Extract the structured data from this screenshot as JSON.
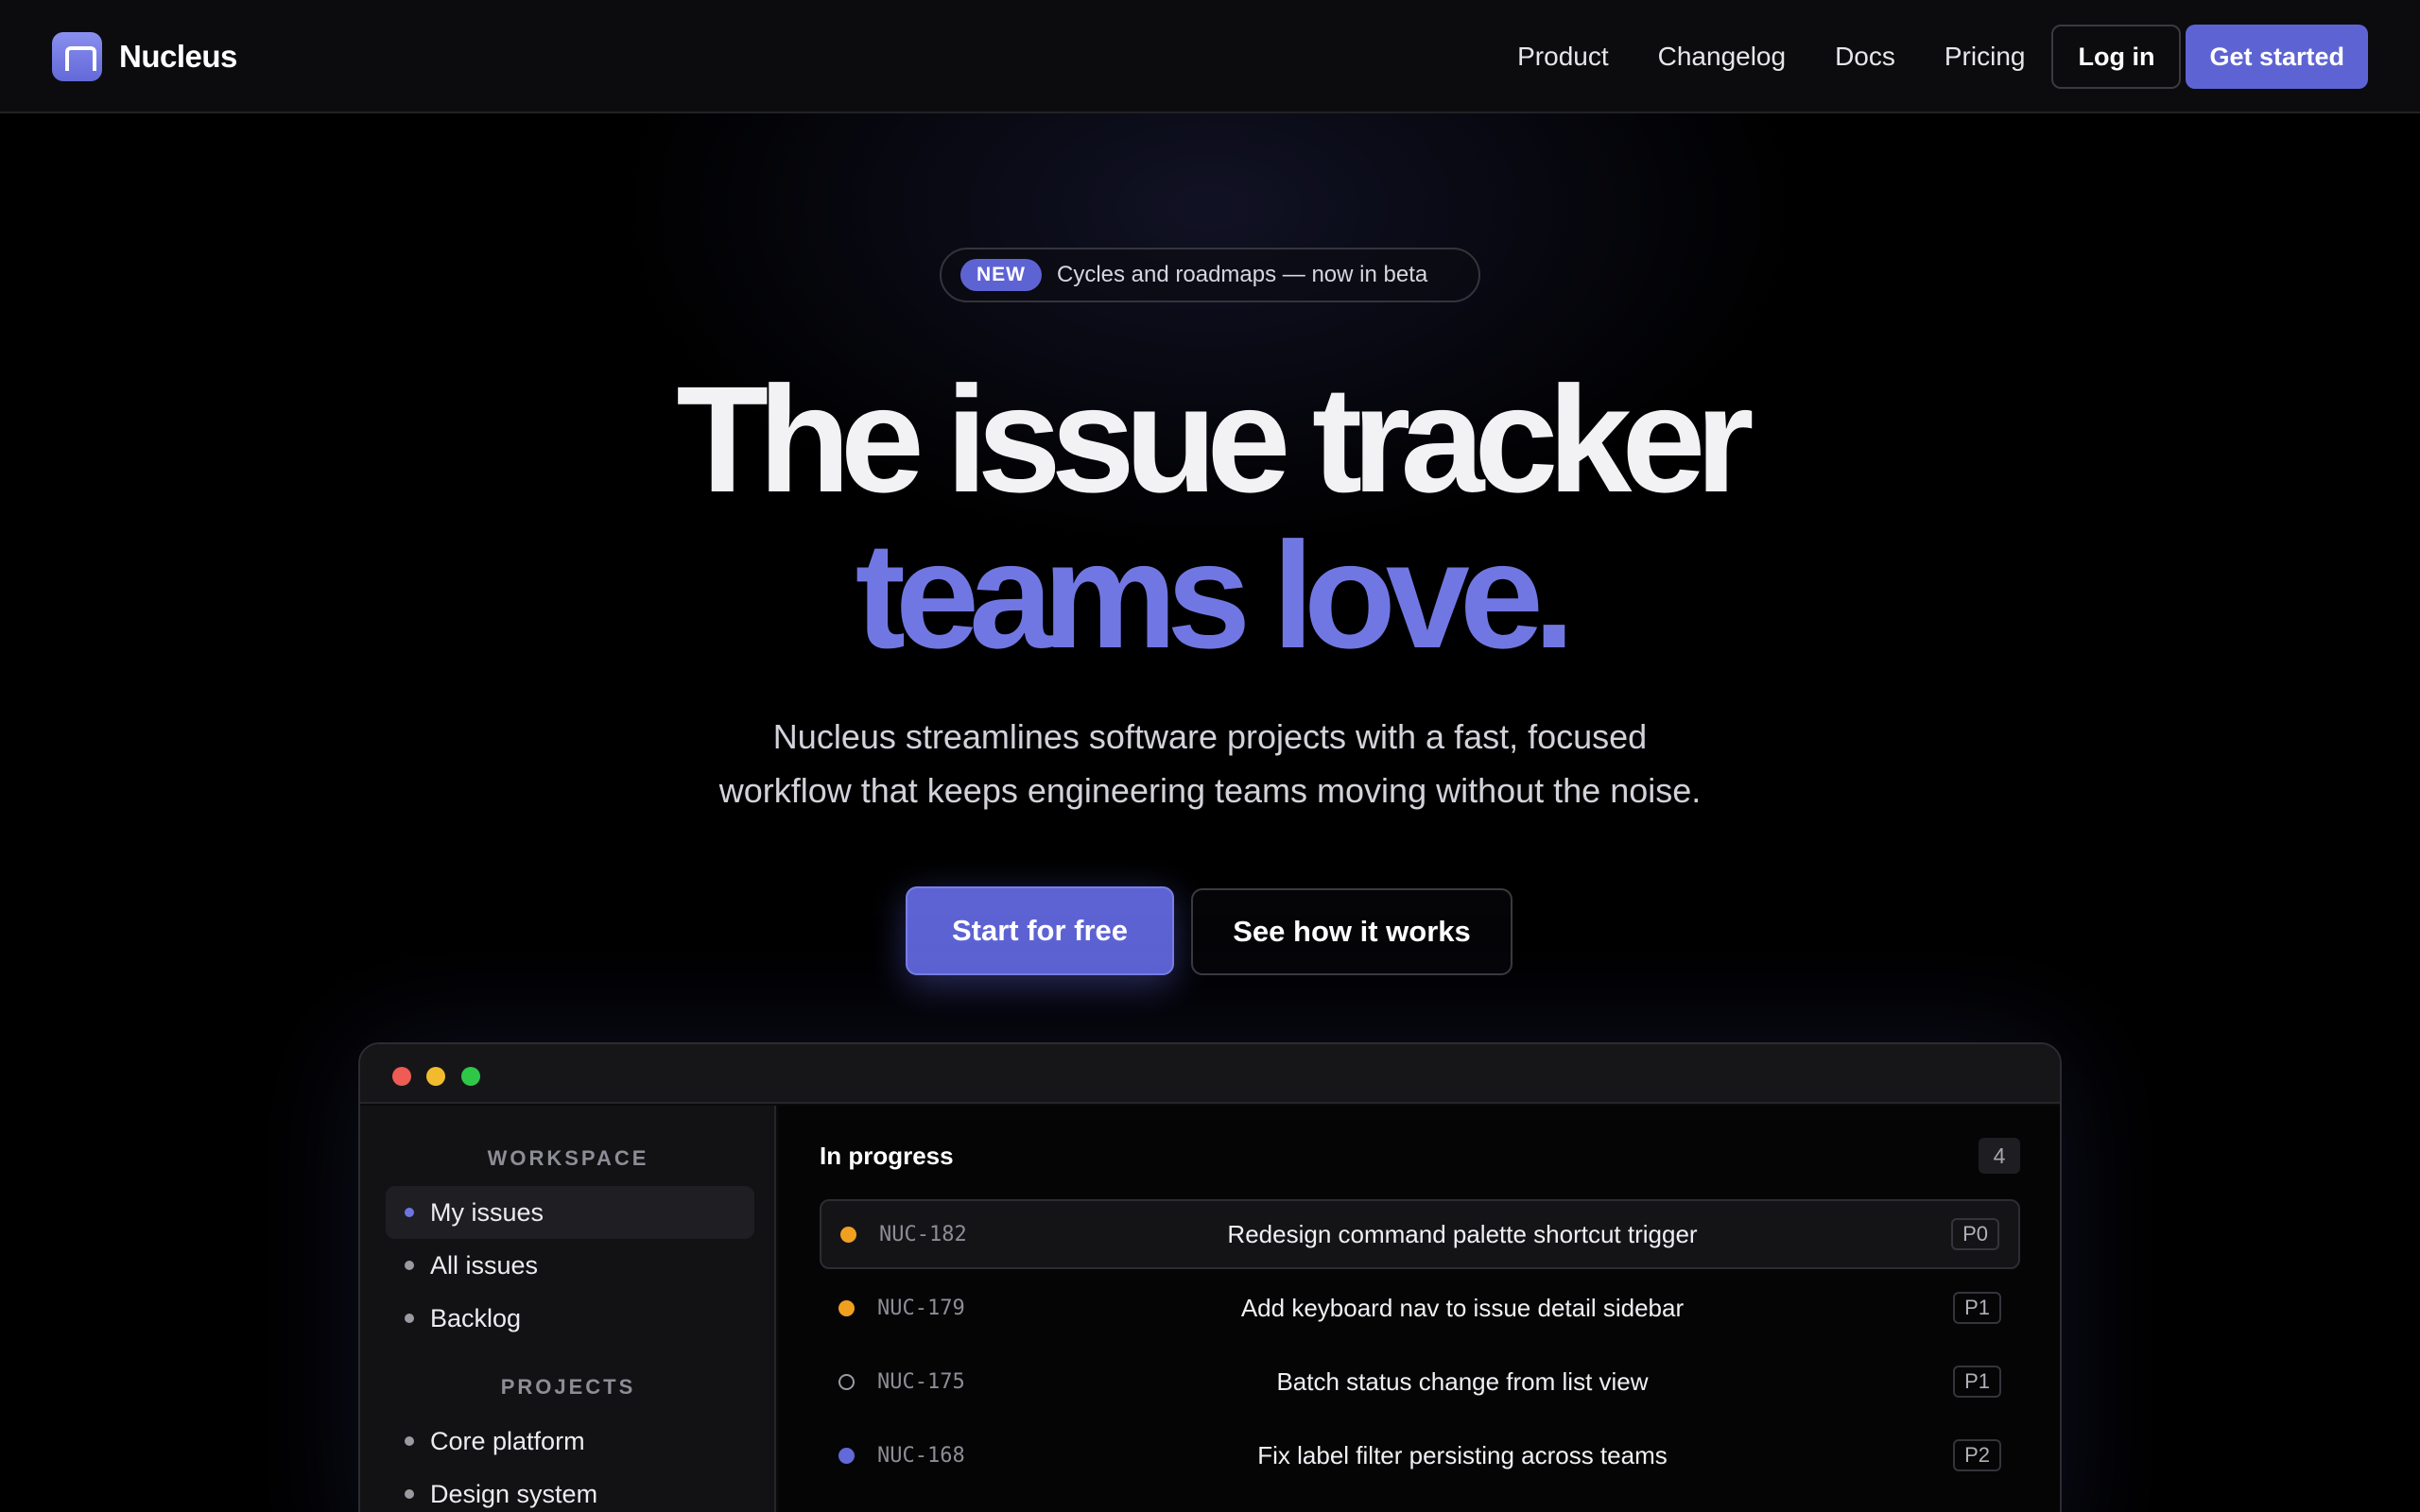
{
  "brand": {
    "name": "Nucleus",
    "logo_icon": "nucleus-logo-icon",
    "accent_color": "#5e63d4"
  },
  "nav": {
    "links": [
      "Product",
      "Changelog",
      "Docs",
      "Pricing"
    ],
    "login_label": "Log in",
    "cta_label": "Get started"
  },
  "hero": {
    "badge": "NEW",
    "badge_text": "Cycles and roadmaps — now in beta",
    "headline_line1": "The issue tracker",
    "headline_line2": "teams love.",
    "subtitle_line1": "Nucleus streamlines software projects with a fast, focused",
    "subtitle_line2": "workflow that keeps engineering teams moving without the noise.",
    "primary_cta": "Start for free",
    "secondary_cta": "See how it works"
  },
  "app_preview": {
    "sidebar": {
      "workspace_label": "WORKSPACE",
      "workspace_items": [
        "My issues",
        "All issues",
        "Backlog"
      ],
      "projects_label": "PROJECTS",
      "project_items": [
        "Core platform",
        "Design system"
      ]
    },
    "main": {
      "title": "In progress",
      "count": "4",
      "issues": [
        {
          "id": "NUC-182",
          "title": "Redesign command palette shortcut trigger",
          "priority": "P0",
          "status": "in-progress"
        },
        {
          "id": "NUC-179",
          "title": "Add keyboard nav to issue detail sidebar",
          "priority": "P1",
          "status": "in-progress"
        },
        {
          "id": "NUC-175",
          "title": "Batch status change from list view",
          "priority": "P1",
          "status": "todo"
        },
        {
          "id": "NUC-168",
          "title": "Fix label filter persisting across teams",
          "priority": "P2",
          "status": "planned"
        }
      ]
    }
  }
}
